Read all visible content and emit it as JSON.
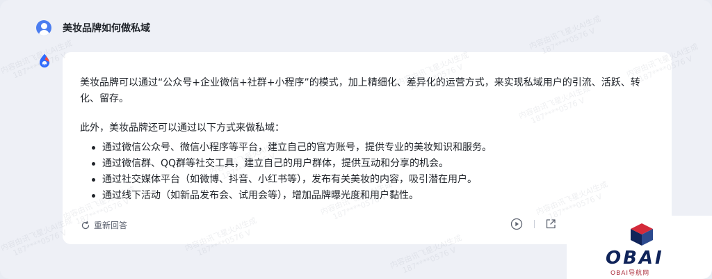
{
  "user_message": "美妆品牌如何做私域",
  "answer": {
    "paragraph1": "美妆品牌可以通过“公众号+企业微信+社群+小程序”的模式，加上精细化、差异化的运营方式，来实现私域用户的引流、活跃、转化、留存。",
    "paragraph2": "此外，美妆品牌还可以通过以下方式来做私域：",
    "bullets": [
      "通过微信公众号、微信小程序等平台，建立自己的官方账号，提供专业的美妆知识和服务。",
      "通过微信群、QQ群等社交工具，建立自己的用户群体，提供互动和分享的机会。",
      "通过社交媒体平台（如微博、抖音、小红书等），发布有关美妆的内容，吸引潜在用户。",
      "通过线下活动（如新品发布会、试用会等），增加品牌曝光度和用户黏性。"
    ]
  },
  "actions": {
    "regenerate_label": "重新回答"
  },
  "watermark": {
    "line1": "内容由讯飞星火AI生成",
    "line2": "187****0576 V"
  },
  "brand": {
    "name": "OBAI",
    "subtitle": "OBAI导航网"
  },
  "icons": {
    "user_avatar": "user-avatar-icon",
    "bot_logo": "spark-logo-icon",
    "regenerate": "refresh-icon",
    "play": "play-circle-icon",
    "share": "share-icon",
    "brand_logo": "cube-logo-icon"
  },
  "colors": {
    "avatar": "#4b7df0",
    "bot_blue": "#2f6bff",
    "bot_red": "#ff4a3a",
    "brand_navy": "#10245a",
    "brand_red": "#d42a3a"
  }
}
